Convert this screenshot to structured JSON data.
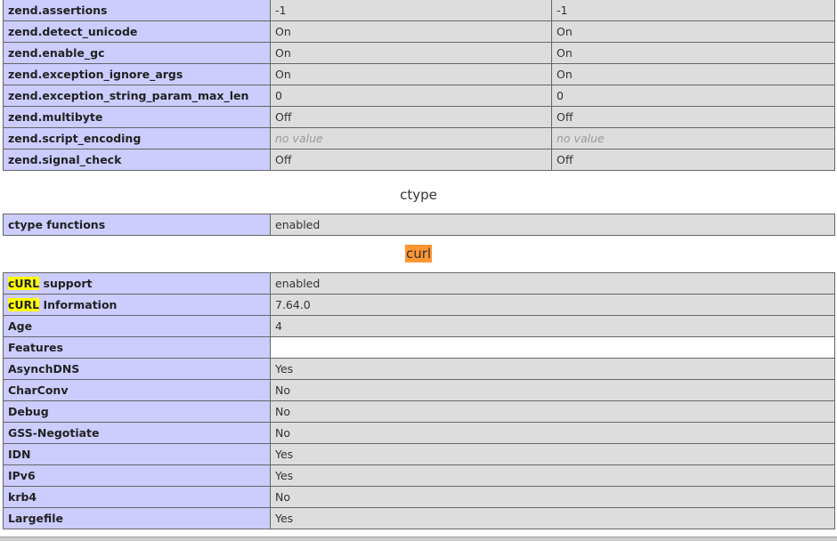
{
  "zend_table": {
    "rows": [
      {
        "directive": "zend.assertions",
        "local": "-1",
        "master": "-1"
      },
      {
        "directive": "zend.detect_unicode",
        "local": "On",
        "master": "On"
      },
      {
        "directive": "zend.enable_gc",
        "local": "On",
        "master": "On"
      },
      {
        "directive": "zend.exception_ignore_args",
        "local": "On",
        "master": "On"
      },
      {
        "directive": "zend.exception_string_param_max_len",
        "local": "0",
        "master": "0"
      },
      {
        "directive": "zend.multibyte",
        "local": "Off",
        "master": "Off"
      },
      {
        "directive": "zend.script_encoding",
        "local": "no value",
        "master": "no value"
      },
      {
        "directive": "zend.signal_check",
        "local": "Off",
        "master": "Off"
      }
    ]
  },
  "ctype": {
    "title": "ctype",
    "rows": [
      {
        "label": "ctype functions",
        "value": "enabled"
      }
    ]
  },
  "curl": {
    "title": "curl",
    "highlight_word": "cURL",
    "support_suffix": " support",
    "support_value": "enabled",
    "information_suffix": " Information",
    "information_value": "7.64.0",
    "rows": [
      {
        "label": "Age",
        "value": "4"
      },
      {
        "label": "Features",
        "value": ""
      },
      {
        "label": "AsynchDNS",
        "value": "Yes"
      },
      {
        "label": "CharConv",
        "value": "No"
      },
      {
        "label": "Debug",
        "value": "No"
      },
      {
        "label": "GSS-Negotiate",
        "value": "No"
      },
      {
        "label": "IDN",
        "value": "Yes"
      },
      {
        "label": "IPv6",
        "value": "Yes"
      },
      {
        "label": "krb4",
        "value": "No"
      },
      {
        "label": "Largefile",
        "value": "Yes"
      }
    ]
  },
  "colors": {
    "label_cell": "#ccccff",
    "value_cell": "#dddddd",
    "search_highlight_current": "#ff9632",
    "search_highlight_match": "#ffff00"
  }
}
